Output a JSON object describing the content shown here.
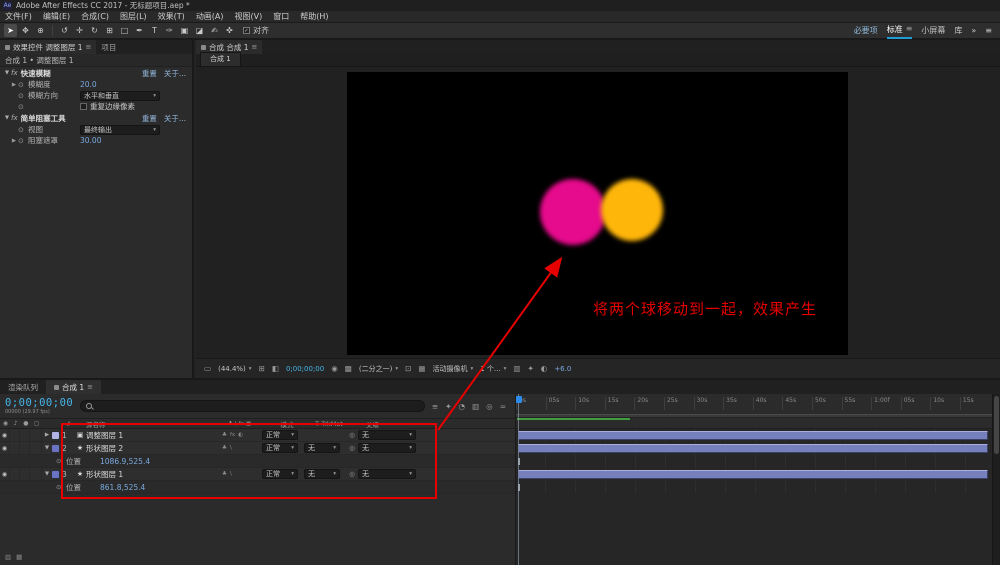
{
  "app": {
    "title": "Adobe After Effects CC 2017 - 无标题项目.aep *"
  },
  "menu": {
    "items": [
      "文件(F)",
      "编辑(E)",
      "合成(C)",
      "图层(L)",
      "效果(T)",
      "动画(A)",
      "视图(V)",
      "窗口",
      "帮助(H)"
    ]
  },
  "toolbar": {
    "snap_label": "对齐",
    "workspaces": {
      "essentials": "必要项",
      "standard": "标准",
      "small_screen": "小屏幕",
      "library": "库"
    }
  },
  "icons": {
    "ae_logo": "Ae",
    "selection_tool": "➤",
    "hand_tool": "✥",
    "zoom_tool": "⊕",
    "orbit_tool": "↺",
    "pan_camera_tool": "✛",
    "rotate_tool": "↻",
    "pan_behind_tool": "⊞",
    "shape_tool": "□",
    "pen_tool": "✒",
    "text_tool": "T",
    "brush_tool": "✑",
    "stamp_tool": "▣",
    "eraser_tool": "◪",
    "roto_tool": "✍",
    "puppet_tool": "✜",
    "hamburger": "≡",
    "chevrons": "»",
    "caret": "▾",
    "tri_right": "▶",
    "tri_down": "▼",
    "stopwatch": "⊙",
    "fx_badge": "fx",
    "star": "★",
    "adjustment_icon": "▣",
    "eye": "◉",
    "audio": "♪",
    "solo": "●",
    "lock": "◻",
    "pickwhip": "◎",
    "clover": "♣",
    "half": "◐",
    "flowchart": "≡",
    "draft3d": "✦",
    "shy": "◔",
    "frame_blend": "▥",
    "motion_blur": "◎",
    "graph_editor": "≈",
    "monitor": "▭",
    "safe_margins": "⊞",
    "channels": "◧",
    "snapshot": "◉",
    "transparency": "▩",
    "roi": "⊡",
    "grid": "▦",
    "exposure": "◐",
    "backslash": "\\"
  },
  "effects_panel": {
    "tab": "效果控件 调整图层 1",
    "tab_project": "项目",
    "breadcrumb": "合成 1 • 调整图层 1",
    "reset_label": "重置",
    "about_label": "关于...",
    "effects": [
      {
        "name": "快速模糊",
        "rows": [
          {
            "label": "模糊度",
            "value": "20.0"
          },
          {
            "label": "模糊方向",
            "value": "水平和垂直"
          },
          {
            "label": "重复边缘像素"
          }
        ]
      },
      {
        "name": "简单阻塞工具",
        "rows": [
          {
            "label": "视图",
            "value": "最终输出"
          },
          {
            "label": "阻塞遮罩",
            "value": "30.00"
          }
        ]
      }
    ]
  },
  "comp_panel": {
    "tab": "合成 合成 1",
    "viewer_tab": "合成 1",
    "annotation_text": "将两个球移动到一起，效果产生",
    "status": {
      "zoom": "(44.4%)",
      "timecode": "0;00;00;00",
      "resolution": "(二分之一)",
      "camera": "活动摄像机",
      "views": "1 个...",
      "exposure": "+6.0"
    }
  },
  "timeline": {
    "tab_render_queue": "渲染队列",
    "tab_comp": "合成 1",
    "timecode": "0;00;00;00",
    "frame_info": "00000 (29.97 fps)",
    "columns": {
      "hash": "#",
      "source_name": "源名称",
      "mode": "模式",
      "trkmat": "T TrkMat",
      "parent": "父级"
    },
    "position_label": "位置",
    "layers": [
      {
        "num": "1",
        "name": "调整图层 1",
        "mode": "正常",
        "parent": "无"
      },
      {
        "num": "2",
        "name": "形状图层 2",
        "mode": "正常",
        "trkmat": "无",
        "parent": "无",
        "position": "1086.9,525.4"
      },
      {
        "num": "3",
        "name": "形状图层 1",
        "mode": "正常",
        "trkmat": "无",
        "parent": "无",
        "position": "861.8,525.4"
      }
    ],
    "ruler": [
      "0s",
      "05s",
      "10s",
      "15s",
      "20s",
      "25s",
      "30s",
      "35s",
      "40s",
      "45s",
      "50s",
      "55s",
      "1:00f",
      "05s",
      "10s",
      "15s"
    ]
  },
  "colors": {
    "workspace_accent": "#1f9cd6",
    "value_blue": "#7aa9dd",
    "timecode_blue": "#45b5e8",
    "magenta": "#e60a8c",
    "orange": "#ffb60a",
    "annotation_red": "#e60000",
    "layer_bar": "#7680bd",
    "preview_green": "#3f9e3f"
  }
}
